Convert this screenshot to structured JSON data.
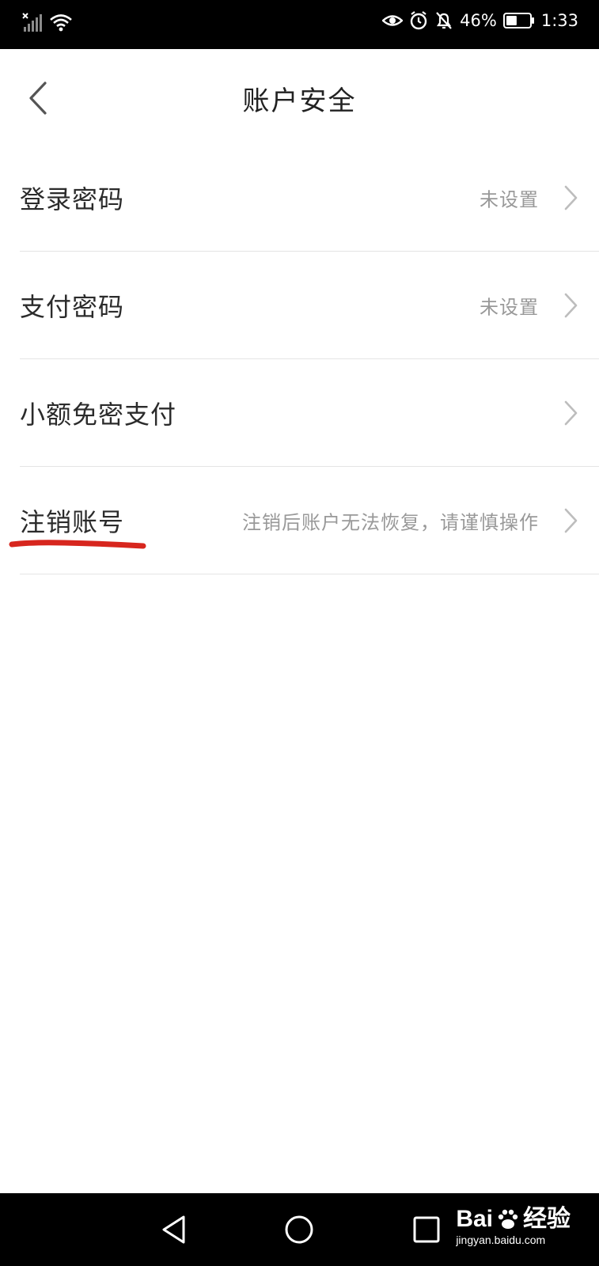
{
  "status_bar": {
    "battery_percent": "46%",
    "time": "1:33",
    "icons": [
      "signal-icon",
      "wifi-icon",
      "eye-icon",
      "alarm-icon",
      "bell-muted-icon",
      "battery-icon"
    ],
    "battery_level": 0.46
  },
  "header": {
    "title": "账户安全",
    "back_icon": "chevron-left-icon"
  },
  "settings": {
    "items": [
      {
        "label": "登录密码",
        "value": "未设置"
      },
      {
        "label": "支付密码",
        "value": "未设置"
      },
      {
        "label": "小额免密支付",
        "value": ""
      },
      {
        "label": "注销账号",
        "value": "注销后账户无法恢复，请谨慎操作",
        "annotation": "red-underline"
      }
    ]
  },
  "android_nav": {
    "buttons": [
      "back-triangle-icon",
      "home-circle-icon",
      "recent-square-icon"
    ]
  },
  "watermark": {
    "brand": "Bai",
    "brand_suffix": "经验",
    "url": "jingyan.baidu.com"
  },
  "colors": {
    "annotation_red": "#d7261e",
    "text_primary": "#2b2b2b",
    "text_secondary": "#999999",
    "divider": "#e4e4e4"
  }
}
